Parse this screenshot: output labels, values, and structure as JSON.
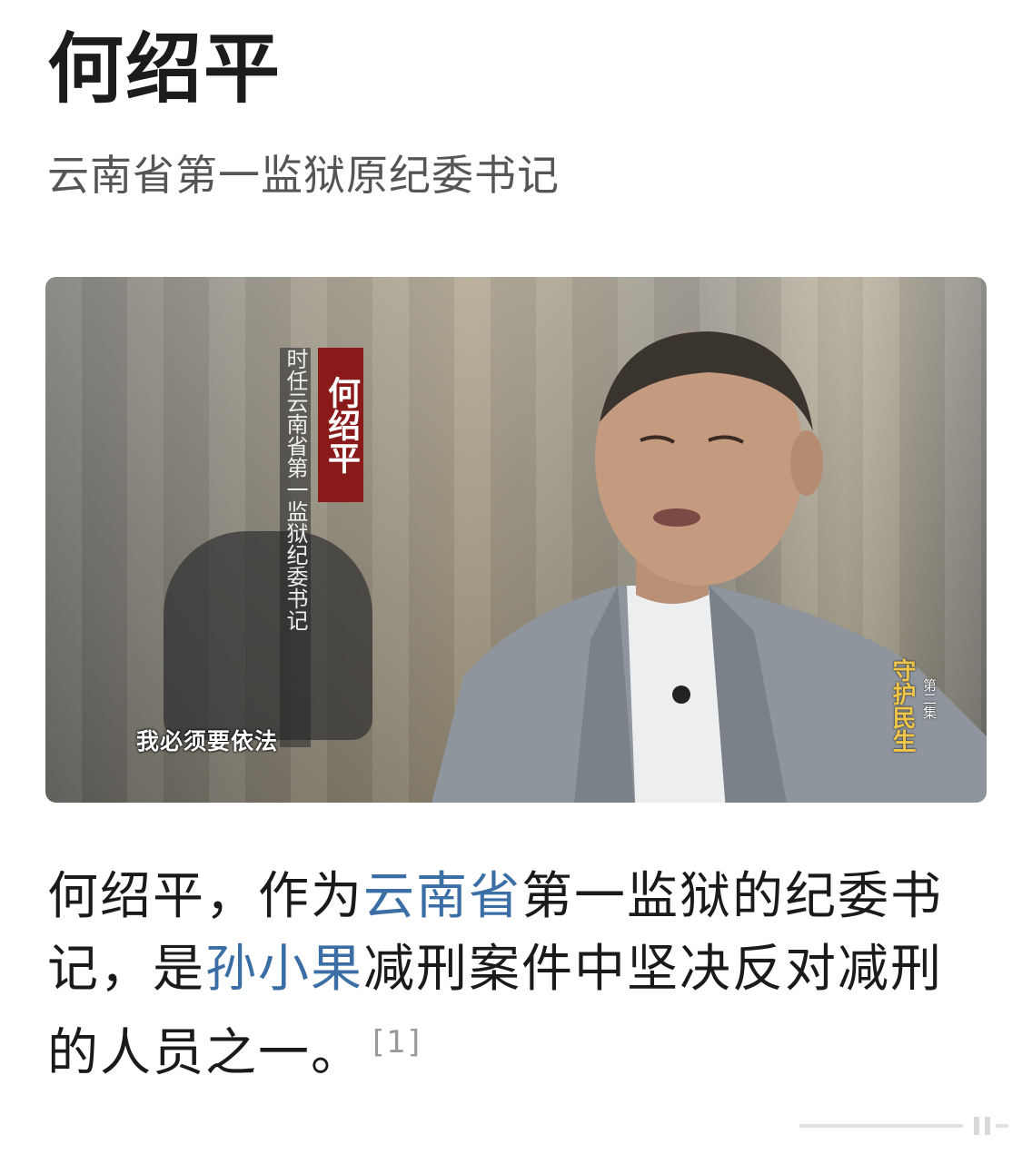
{
  "header": {
    "title": "何绍平",
    "subtitle": "云南省第一监狱原纪委书记"
  },
  "photo": {
    "name_badge": "何绍平",
    "role_caption": "时任云南省第一监狱纪委书记",
    "subtitle_caption": "我必须要依法",
    "program_title": "守护民生",
    "program_episode": "第二集"
  },
  "body": {
    "part1": "何绍平，作为",
    "link1": "云南省",
    "part2": "第一监狱的纪委书记，是",
    "link2": "孙小果",
    "part3": "减刑案件中坚决反对减刑的人员之一。",
    "reference": "[1]"
  },
  "colors": {
    "link": "#3a6ea5",
    "name_badge_bg": "#8a1a1a",
    "program_title": "#f0c64a"
  }
}
